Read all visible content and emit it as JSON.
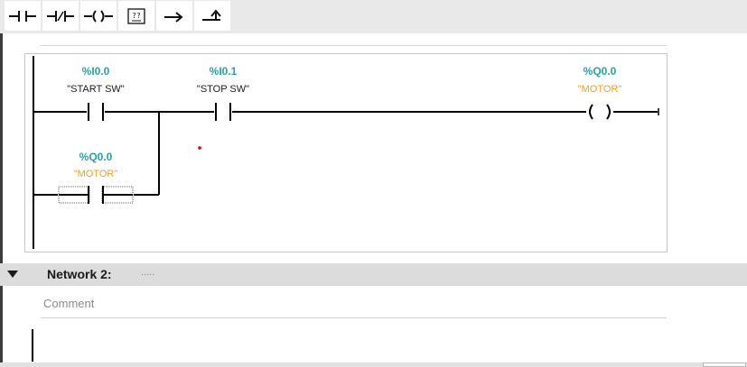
{
  "toolbar": {
    "buttons": [
      {
        "name": "normally-open-contact-button",
        "icon": "no-contact-icon"
      },
      {
        "name": "normally-closed-contact-button",
        "icon": "nc-contact-icon"
      },
      {
        "name": "output-coil-button",
        "icon": "coil-icon"
      },
      {
        "name": "empty-box-button",
        "icon": "empty-box-icon",
        "glyph": "??"
      },
      {
        "name": "open-branch-button",
        "icon": "open-branch-icon"
      },
      {
        "name": "close-branch-button",
        "icon": "close-branch-icon"
      }
    ]
  },
  "network1": {
    "start_contact": {
      "address": "%I0.0",
      "tag": "\"START SW\""
    },
    "stop_contact": {
      "address": "%I0.1",
      "tag": "\"STOP SW\""
    },
    "output_coil": {
      "address": "%Q0.0",
      "tag": "\"MOTOR\""
    },
    "holding_contact": {
      "address": "%Q0.0",
      "tag": "\"MOTOR\""
    }
  },
  "network2": {
    "title": "Network 2:",
    "dots": ".....",
    "comment_placeholder": "Comment"
  },
  "colors": {
    "address": "#2a9fa6",
    "tag": "#1a1a1a",
    "output_tag": "#f0a020",
    "error_dot": "#e00000"
  }
}
